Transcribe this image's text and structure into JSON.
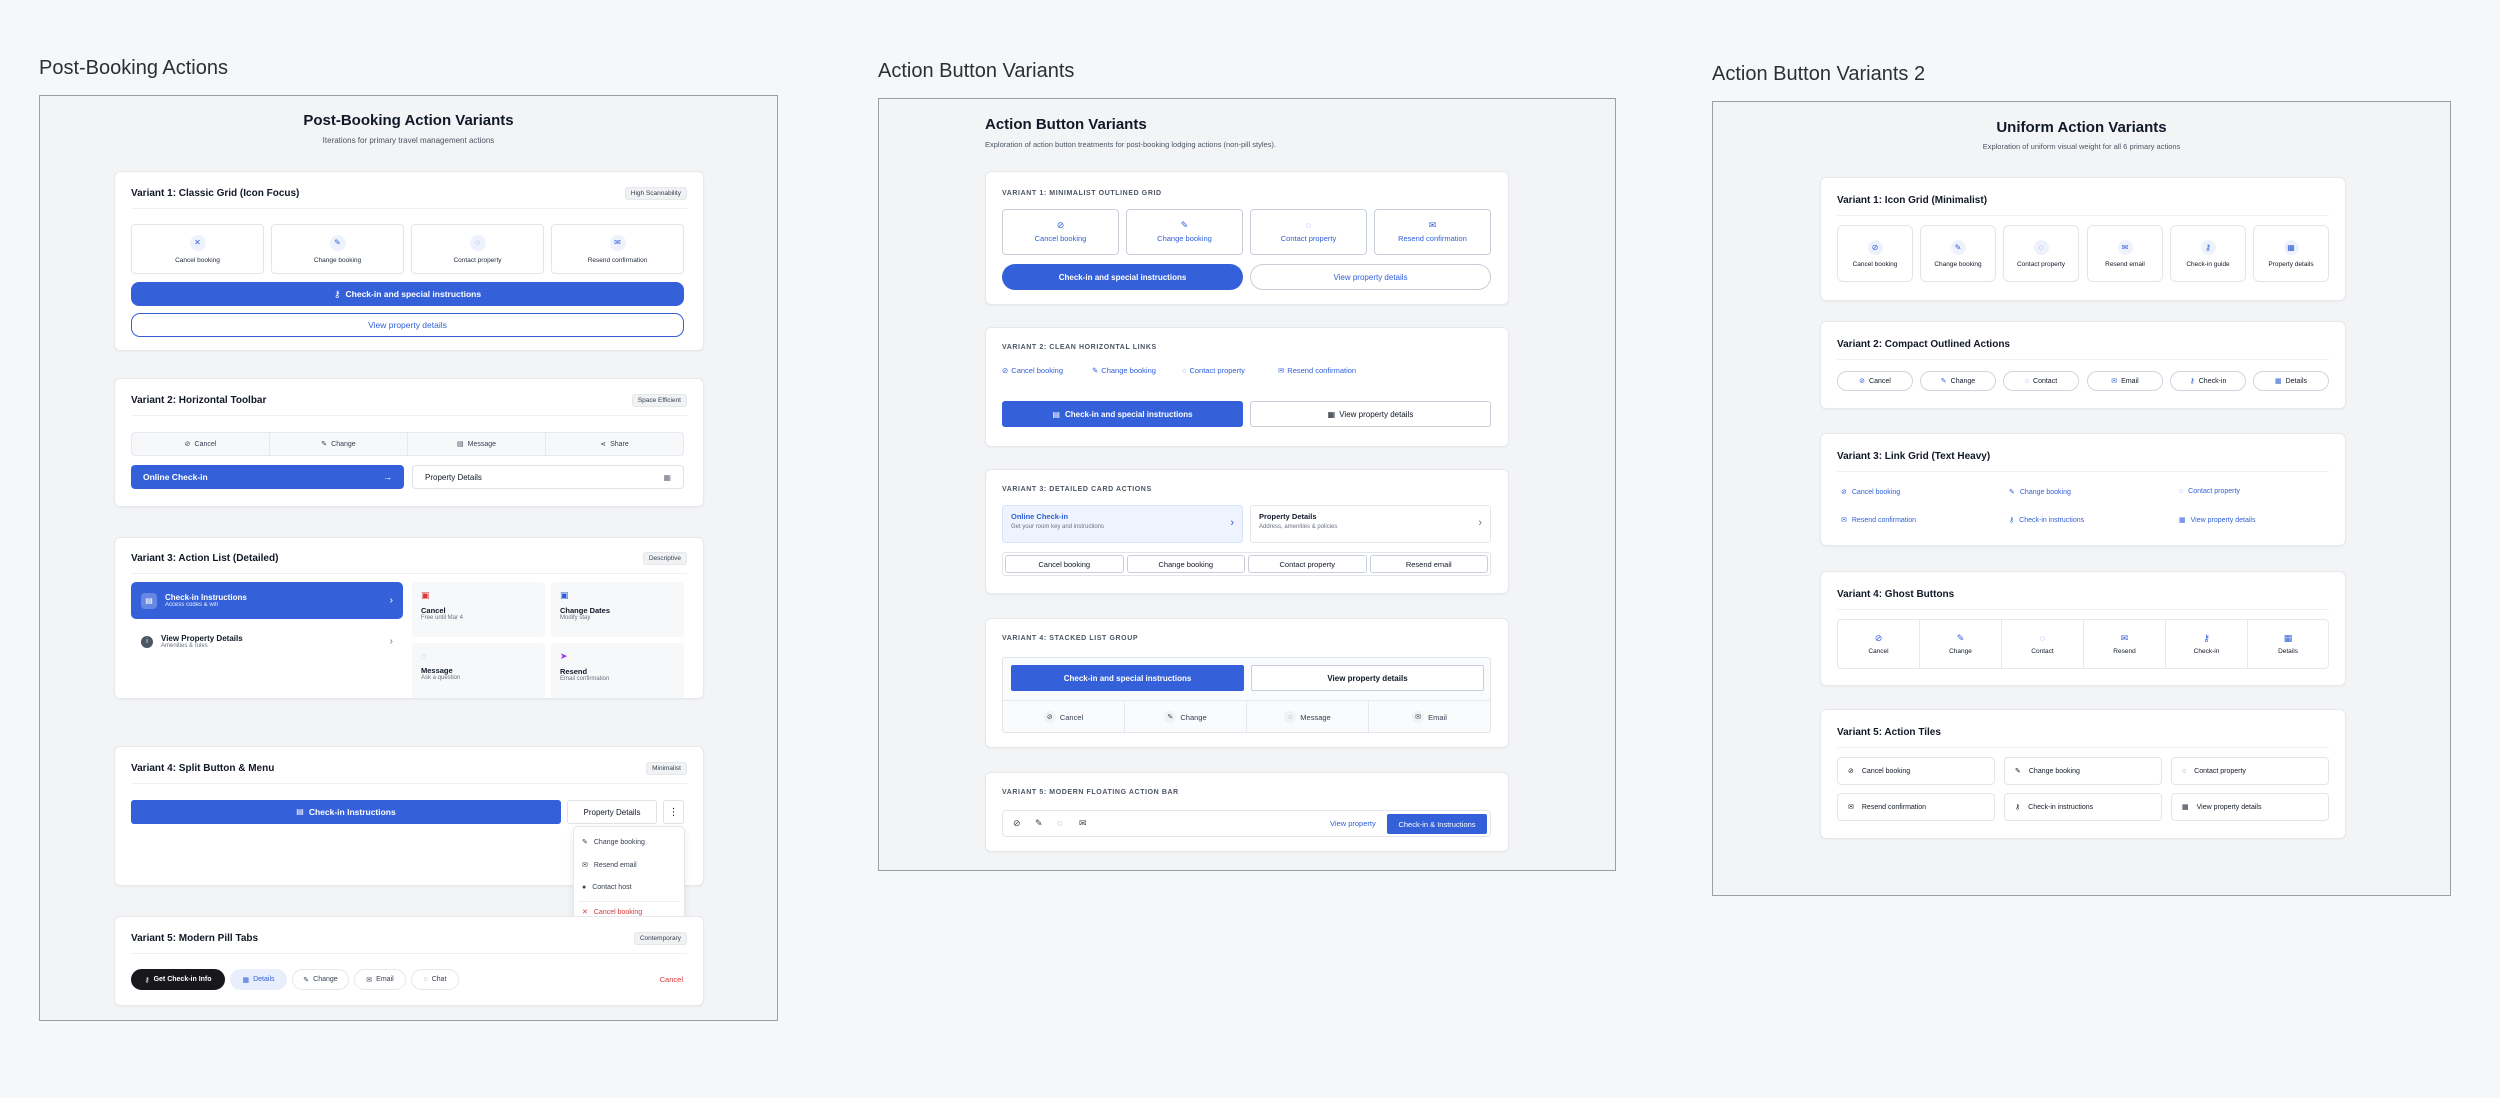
{
  "boards": {
    "b1": "Post-Booking Actions",
    "b2": "Action Button Variants",
    "b3": "Action Button Variants 2"
  },
  "f1": {
    "title": "Post-Booking Action Variants",
    "subtitle": "Iterations for primary travel management actions",
    "v1": {
      "title": "Variant 1: Classic Grid (Icon Focus)",
      "badge": "High Scannability",
      "tiles": [
        "Cancel booking",
        "Change booking",
        "Contact property",
        "Resend confirmation"
      ],
      "primary": "Check-in and special instructions",
      "secondary": "View property details"
    },
    "v2": {
      "title": "Variant 2: Horizontal Toolbar",
      "badge": "Space Efficient",
      "items": [
        "Cancel",
        "Change",
        "Message",
        "Share"
      ],
      "primary": "Online Check-in",
      "secondary": "Property Details"
    },
    "v3": {
      "title": "Variant 3: Action List (Detailed)",
      "badge": "Descriptive",
      "checkin_title": "Check-in Instructions",
      "checkin_sub": "Access codes & wifi",
      "details_title": "View Property Details",
      "details_sub": "Amenities & rules",
      "cells": [
        {
          "t": "Cancel",
          "s": "Free until Mar 4"
        },
        {
          "t": "Change Dates",
          "s": "Modify stay"
        },
        {
          "t": "Message",
          "s": "Ask a question"
        },
        {
          "t": "Resend",
          "s": "Email confirmation"
        }
      ]
    },
    "v4": {
      "title": "Variant 4: Split Button & Menu",
      "badge": "Minimalist",
      "primary": "Check-in Instructions",
      "secondary": "Property Details",
      "menu": [
        "Change booking",
        "Resend email",
        "Contact host",
        "Cancel booking"
      ]
    },
    "v5": {
      "title": "Variant 5: Modern Pill Tabs",
      "badge": "Contemporary",
      "pills": [
        "Get Check-in Info",
        "Details",
        "Change",
        "Email",
        "Chat"
      ],
      "cancel": "Cancel"
    }
  },
  "f2": {
    "title": "Action Button Variants",
    "subtitle": "Exploration of action button treatments for post-booking lodging actions (non-pill styles).",
    "v1": {
      "label": "VARIANT 1: MINIMALIST OUTLINED GRID",
      "tiles": [
        "Cancel booking",
        "Change booking",
        "Contact property",
        "Resend confirmation"
      ],
      "primary": "Check-in and special instructions",
      "secondary": "View property details"
    },
    "v2": {
      "label": "VARIANT 2: CLEAN HORIZONTAL LINKS",
      "links": [
        "Cancel booking",
        "Change booking",
        "Contact property",
        "Resend confirmation"
      ],
      "primary": "Check-in and special instructions",
      "secondary": "View property details"
    },
    "v3": {
      "label": "VARIANT 3: DETAILED CARD ACTIONS",
      "card1_title": "Online Check-in",
      "card1_sub": "Get your room key and instructions",
      "card2_title": "Property Details",
      "card2_sub": "Address, amenities & policies",
      "buttons": [
        "Cancel booking",
        "Change booking",
        "Contact property",
        "Resend email"
      ]
    },
    "v4": {
      "label": "VARIANT 4: STACKED LIST GROUP",
      "primary": "Check-in and special instructions",
      "secondary": "View property details",
      "items": [
        "Cancel",
        "Change",
        "Message",
        "Email"
      ]
    },
    "v5": {
      "label": "VARIANT 5: MODERN FLOATING ACTION BAR",
      "link": "View property",
      "primary": "Check-in & Instructions"
    }
  },
  "f3": {
    "title": "Uniform Action Variants",
    "subtitle": "Exploration of uniform visual weight for all 6 primary actions",
    "v1": {
      "title": "Variant 1: Icon Grid (Minimalist)",
      "tiles": [
        "Cancel booking",
        "Change booking",
        "Contact property",
        "Resend email",
        "Check-in guide",
        "Property details"
      ]
    },
    "v2": {
      "title": "Variant 2: Compact Outlined Actions",
      "pills": [
        "Cancel",
        "Change",
        "Contact",
        "Email",
        "Check-in",
        "Details"
      ]
    },
    "v3": {
      "title": "Variant 3: Link Grid (Text Heavy)",
      "links": [
        "Cancel booking",
        "Change booking",
        "Contact property",
        "Resend confirmation",
        "Check-in instructions",
        "View property details"
      ]
    },
    "v4": {
      "title": "Variant 4: Ghost Buttons",
      "items": [
        "Cancel",
        "Change",
        "Contact",
        "Resend",
        "Check-in",
        "Details"
      ]
    },
    "v5": {
      "title": "Variant 5: Action Tiles",
      "tiles": [
        "Cancel booking",
        "Change booking",
        "Contact property",
        "Resend confirmation",
        "Check-in instructions",
        "View property details"
      ]
    }
  },
  "colors": {
    "accent": "#3461d9",
    "danger": "#d93636",
    "dark": "#17171c"
  }
}
